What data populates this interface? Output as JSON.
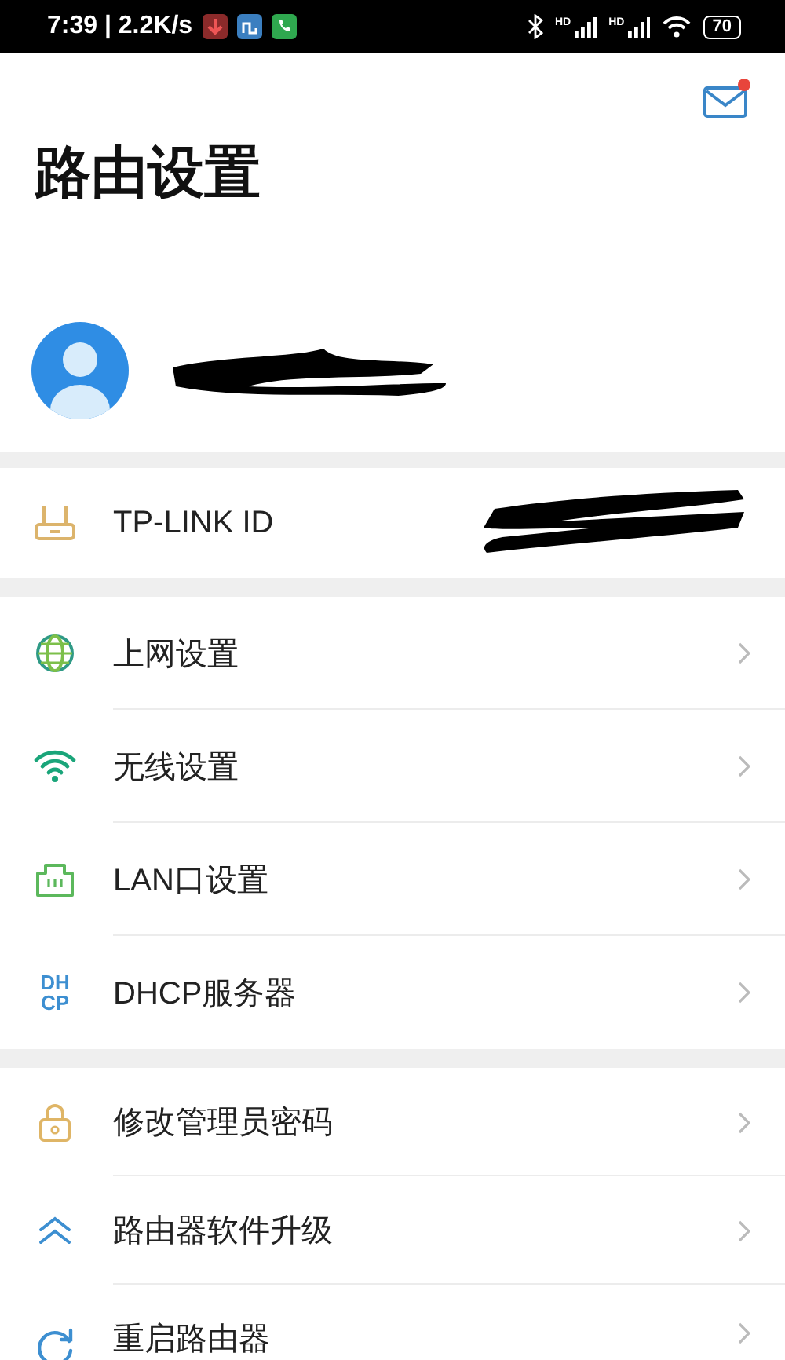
{
  "status_bar": {
    "time": "7:39 | 2.2K/s",
    "signal_labels": [
      "HD",
      "HD"
    ],
    "battery": "70"
  },
  "header": {
    "title": "路由设置",
    "mail_unread": true
  },
  "account": {
    "label": "TP-LINK ID",
    "kind": "router"
  },
  "groups": [
    {
      "items": [
        {
          "label": "上网设置",
          "kind": "globe"
        },
        {
          "label": "无线设置",
          "kind": "wifi"
        },
        {
          "label": "LAN口设置",
          "kind": "lan"
        },
        {
          "label": "DHCP服务器",
          "kind": "text",
          "icon_lines": [
            "DH",
            "CP"
          ]
        }
      ]
    },
    {
      "items": [
        {
          "label": "修改管理员密码",
          "kind": "lock"
        },
        {
          "label": "路由器软件升级",
          "kind": "upgrade"
        },
        {
          "label": "重启路由器",
          "kind": "restart"
        }
      ]
    }
  ]
}
